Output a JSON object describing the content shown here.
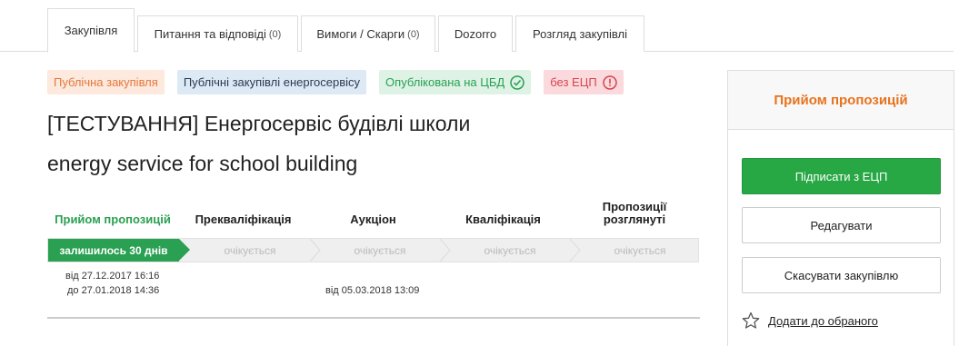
{
  "tabs": [
    {
      "label": "Закупівля",
      "count": ""
    },
    {
      "label": "Питання та відповіді",
      "count": "(0)"
    },
    {
      "label": "Вимоги / Скарги",
      "count": "(0)"
    },
    {
      "label": "Dozorro",
      "count": ""
    },
    {
      "label": "Розгляд закупівлі",
      "count": ""
    }
  ],
  "badges": {
    "public": "Публічна закупівля",
    "energy": "Публічні закупівлі енергосервісу",
    "published": "Опублікована на ЦБД",
    "no_signature": "без ЕЦП"
  },
  "title": {
    "line1": "[ТЕСТУВАННЯ] Енергосервіс будівлі школи",
    "line2": "energy service for school building"
  },
  "stages": {
    "labels": [
      "Прийом пропозицій",
      "Прекваліфікація",
      "Аукціон",
      "Кваліфікація",
      "Пропозиції розглянуті"
    ],
    "status": [
      "залишилось 30 днів",
      "очікується",
      "очікується",
      "очікується",
      "очікується"
    ],
    "dates": {
      "offers_from": "від 27.12.2017 16:16",
      "offers_to": "до 27.01.2018 14:36",
      "auction_from": "від 05.03.2018 13:09"
    }
  },
  "panel": {
    "heading": "Прийом пропозицій",
    "sign_button": "Підписати з ЕЦП",
    "edit_button": "Редагувати",
    "cancel_button": "Скасувати закупівлю",
    "favorite_link": "Додати до обраного"
  },
  "colors": {
    "accent_green": "#2aa052",
    "accent_orange": "#e8731d"
  },
  "icons": {
    "published": "check-circle-icon",
    "no_signature": "exclamation-circle-icon",
    "favorite": "star-icon"
  }
}
